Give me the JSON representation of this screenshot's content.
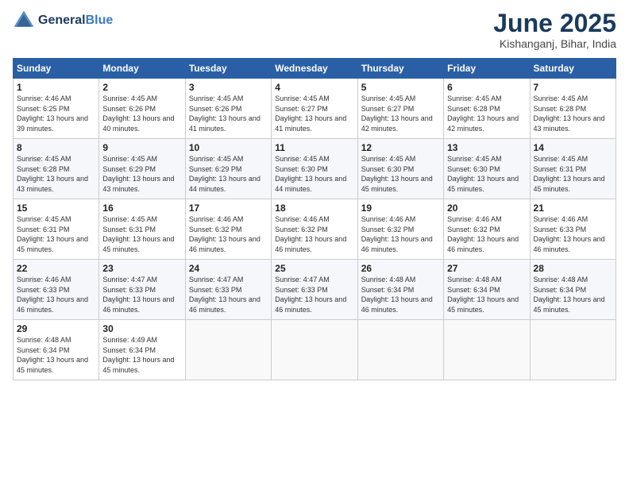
{
  "header": {
    "logo_general": "General",
    "logo_blue": "Blue",
    "month_title": "June 2025",
    "location": "Kishanganj, Bihar, India"
  },
  "days_of_week": [
    "Sunday",
    "Monday",
    "Tuesday",
    "Wednesday",
    "Thursday",
    "Friday",
    "Saturday"
  ],
  "weeks": [
    [
      {
        "day": "1",
        "sunrise": "Sunrise: 4:46 AM",
        "sunset": "Sunset: 6:25 PM",
        "daylight": "Daylight: 13 hours and 39 minutes."
      },
      {
        "day": "2",
        "sunrise": "Sunrise: 4:45 AM",
        "sunset": "Sunset: 6:26 PM",
        "daylight": "Daylight: 13 hours and 40 minutes."
      },
      {
        "day": "3",
        "sunrise": "Sunrise: 4:45 AM",
        "sunset": "Sunset: 6:26 PM",
        "daylight": "Daylight: 13 hours and 41 minutes."
      },
      {
        "day": "4",
        "sunrise": "Sunrise: 4:45 AM",
        "sunset": "Sunset: 6:27 PM",
        "daylight": "Daylight: 13 hours and 41 minutes."
      },
      {
        "day": "5",
        "sunrise": "Sunrise: 4:45 AM",
        "sunset": "Sunset: 6:27 PM",
        "daylight": "Daylight: 13 hours and 42 minutes."
      },
      {
        "day": "6",
        "sunrise": "Sunrise: 4:45 AM",
        "sunset": "Sunset: 6:28 PM",
        "daylight": "Daylight: 13 hours and 42 minutes."
      },
      {
        "day": "7",
        "sunrise": "Sunrise: 4:45 AM",
        "sunset": "Sunset: 6:28 PM",
        "daylight": "Daylight: 13 hours and 43 minutes."
      }
    ],
    [
      {
        "day": "8",
        "sunrise": "Sunrise: 4:45 AM",
        "sunset": "Sunset: 6:28 PM",
        "daylight": "Daylight: 13 hours and 43 minutes."
      },
      {
        "day": "9",
        "sunrise": "Sunrise: 4:45 AM",
        "sunset": "Sunset: 6:29 PM",
        "daylight": "Daylight: 13 hours and 43 minutes."
      },
      {
        "day": "10",
        "sunrise": "Sunrise: 4:45 AM",
        "sunset": "Sunset: 6:29 PM",
        "daylight": "Daylight: 13 hours and 44 minutes."
      },
      {
        "day": "11",
        "sunrise": "Sunrise: 4:45 AM",
        "sunset": "Sunset: 6:30 PM",
        "daylight": "Daylight: 13 hours and 44 minutes."
      },
      {
        "day": "12",
        "sunrise": "Sunrise: 4:45 AM",
        "sunset": "Sunset: 6:30 PM",
        "daylight": "Daylight: 13 hours and 45 minutes."
      },
      {
        "day": "13",
        "sunrise": "Sunrise: 4:45 AM",
        "sunset": "Sunset: 6:30 PM",
        "daylight": "Daylight: 13 hours and 45 minutes."
      },
      {
        "day": "14",
        "sunrise": "Sunrise: 4:45 AM",
        "sunset": "Sunset: 6:31 PM",
        "daylight": "Daylight: 13 hours and 45 minutes."
      }
    ],
    [
      {
        "day": "15",
        "sunrise": "Sunrise: 4:45 AM",
        "sunset": "Sunset: 6:31 PM",
        "daylight": "Daylight: 13 hours and 45 minutes."
      },
      {
        "day": "16",
        "sunrise": "Sunrise: 4:45 AM",
        "sunset": "Sunset: 6:31 PM",
        "daylight": "Daylight: 13 hours and 45 minutes."
      },
      {
        "day": "17",
        "sunrise": "Sunrise: 4:46 AM",
        "sunset": "Sunset: 6:32 PM",
        "daylight": "Daylight: 13 hours and 46 minutes."
      },
      {
        "day": "18",
        "sunrise": "Sunrise: 4:46 AM",
        "sunset": "Sunset: 6:32 PM",
        "daylight": "Daylight: 13 hours and 46 minutes."
      },
      {
        "day": "19",
        "sunrise": "Sunrise: 4:46 AM",
        "sunset": "Sunset: 6:32 PM",
        "daylight": "Daylight: 13 hours and 46 minutes."
      },
      {
        "day": "20",
        "sunrise": "Sunrise: 4:46 AM",
        "sunset": "Sunset: 6:32 PM",
        "daylight": "Daylight: 13 hours and 46 minutes."
      },
      {
        "day": "21",
        "sunrise": "Sunrise: 4:46 AM",
        "sunset": "Sunset: 6:33 PM",
        "daylight": "Daylight: 13 hours and 46 minutes."
      }
    ],
    [
      {
        "day": "22",
        "sunrise": "Sunrise: 4:46 AM",
        "sunset": "Sunset: 6:33 PM",
        "daylight": "Daylight: 13 hours and 46 minutes."
      },
      {
        "day": "23",
        "sunrise": "Sunrise: 4:47 AM",
        "sunset": "Sunset: 6:33 PM",
        "daylight": "Daylight: 13 hours and 46 minutes."
      },
      {
        "day": "24",
        "sunrise": "Sunrise: 4:47 AM",
        "sunset": "Sunset: 6:33 PM",
        "daylight": "Daylight: 13 hours and 46 minutes."
      },
      {
        "day": "25",
        "sunrise": "Sunrise: 4:47 AM",
        "sunset": "Sunset: 6:33 PM",
        "daylight": "Daylight: 13 hours and 46 minutes."
      },
      {
        "day": "26",
        "sunrise": "Sunrise: 4:48 AM",
        "sunset": "Sunset: 6:34 PM",
        "daylight": "Daylight: 13 hours and 46 minutes."
      },
      {
        "day": "27",
        "sunrise": "Sunrise: 4:48 AM",
        "sunset": "Sunset: 6:34 PM",
        "daylight": "Daylight: 13 hours and 45 minutes."
      },
      {
        "day": "28",
        "sunrise": "Sunrise: 4:48 AM",
        "sunset": "Sunset: 6:34 PM",
        "daylight": "Daylight: 13 hours and 45 minutes."
      }
    ],
    [
      {
        "day": "29",
        "sunrise": "Sunrise: 4:48 AM",
        "sunset": "Sunset: 6:34 PM",
        "daylight": "Daylight: 13 hours and 45 minutes."
      },
      {
        "day": "30",
        "sunrise": "Sunrise: 4:49 AM",
        "sunset": "Sunset: 6:34 PM",
        "daylight": "Daylight: 13 hours and 45 minutes."
      },
      null,
      null,
      null,
      null,
      null
    ]
  ]
}
